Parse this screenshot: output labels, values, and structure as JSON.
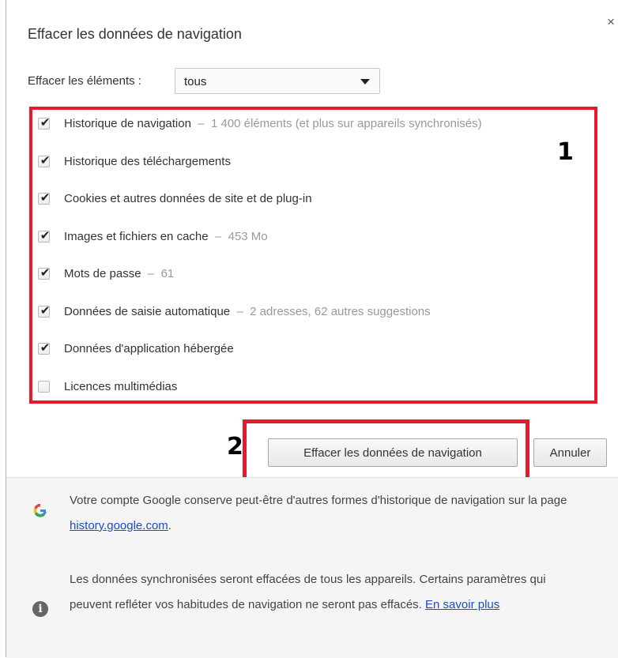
{
  "dialog": {
    "title": "Effacer les données de navigation",
    "close_glyph": "×"
  },
  "time_range": {
    "label": "Effacer les éléments :",
    "selected": "tous"
  },
  "items": [
    {
      "label": "Historique de navigation",
      "detail": "1 400 éléments (et plus sur appareils synchronisés)",
      "checked": true
    },
    {
      "label": "Historique des téléchargements",
      "detail": "",
      "checked": true
    },
    {
      "label": "Cookies et autres données de site et de plug-in",
      "detail": "",
      "checked": true
    },
    {
      "label": "Images et fichiers en cache",
      "detail": "453 Mo",
      "checked": true
    },
    {
      "label": "Mots de passe",
      "detail": "61",
      "checked": true
    },
    {
      "label": "Données de saisie automatique",
      "detail": "2 adresses, 62 autres suggestions",
      "checked": true
    },
    {
      "label": "Données d'application hébergée",
      "detail": "",
      "checked": true
    },
    {
      "label": "Licences multimédias",
      "detail": "",
      "checked": false
    }
  ],
  "annotations": {
    "marker_1": "1",
    "marker_2": "2",
    "highlight_color": "#e8192c"
  },
  "buttons": {
    "clear": "Effacer les données de navigation",
    "cancel": "Annuler"
  },
  "footer": {
    "google_text": "Votre compte Google conserve peut-être d'autres formes d'historique de navigation sur la page ",
    "google_link": "history.google.com",
    "google_suffix": ".",
    "sync_text": "Les données synchronisées seront effacées de tous les appareils. Certains paramètres qui peuvent refléter vos habitudes de navigation ne seront pas effacés. ",
    "sync_link": "En savoir plus",
    "icons": [
      "google-g-icon",
      "info-icon"
    ]
  }
}
